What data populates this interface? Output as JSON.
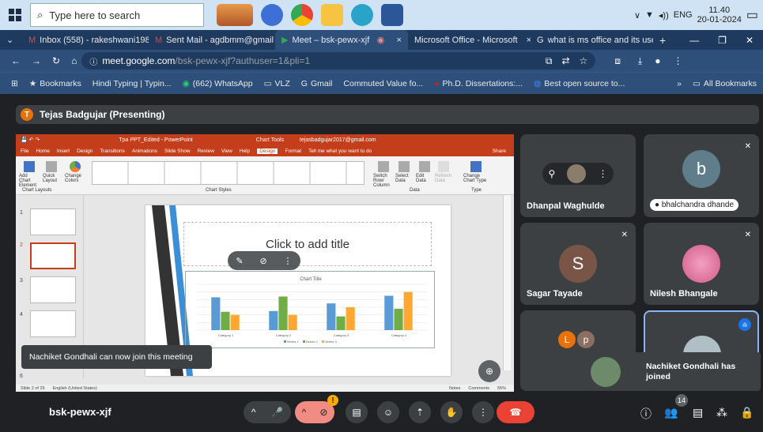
{
  "taskbar": {
    "search_placeholder": "Type here to search",
    "lang": "ENG",
    "time": "11.40",
    "date": "20-01-2024"
  },
  "tabs": [
    {
      "label": "Inbox (558) - rakeshwani198",
      "close": "×"
    },
    {
      "label": "Sent Mail - agdbmm@gmail",
      "close": "×"
    },
    {
      "label": "Meet – bsk-pewx-xjf",
      "close": "×"
    },
    {
      "label": "Microsoft Office - Microsoft",
      "close": "×"
    },
    {
      "label": "what is ms office and its use",
      "close": "×"
    }
  ],
  "new_tab": "+",
  "address": {
    "host": "meet.google.com",
    "path": "/bsk-pewx-xjf?authuser=1&pli=1"
  },
  "bookmarks": [
    "Bookmarks",
    "Hindi Typing | Typin...",
    "(662) WhatsApp",
    "VLZ",
    "Gmail",
    "Commuted Value fo...",
    "Ph.D. Dissertations:...",
    "Best open source to..."
  ],
  "bookmarks_more": "»",
  "all_bookmarks": "All Bookmarks",
  "presenter": {
    "initial": "T",
    "label": "Tejas Badgujar (Presenting)"
  },
  "ppt": {
    "title": "Tpa PPT_Edited - PowerPoint",
    "chart_tools": "Chart Tools",
    "account": "tejasbadgujar2017@gmail.com",
    "menu": [
      "File",
      "Home",
      "Insert",
      "Design",
      "Transitions",
      "Animations",
      "Slide Show",
      "Review",
      "View",
      "Help",
      "Design",
      "Format"
    ],
    "tellme": "Tell me what you want to do",
    "share": "Share",
    "ribbon": {
      "add_chart": "Add Chart Element",
      "quick": "Quick Layout",
      "change_colors": "Change Colors",
      "chart_layouts": "Chart Layouts",
      "chart_styles": "Chart Styles",
      "switch": "Switch Row/ Column",
      "select": "Select Data",
      "edit": "Edit Data",
      "refresh": "Refresh Data",
      "data": "Data",
      "change_type": "Change Chart Type",
      "type": "Type"
    },
    "slide_numbers": [
      "1",
      "2",
      "3",
      "4",
      "6"
    ],
    "slide_title": "Click to add title",
    "chart_title": "Chart Title",
    "status": {
      "slide": "Slide 2 of 29",
      "lang": "English (United States)",
      "notes": "Notes",
      "comments": "Comments",
      "zoom": "55%"
    }
  },
  "chart_data": {
    "type": "bar",
    "categories": [
      "Category 1",
      "Category 2",
      "Category 3",
      "Category 4"
    ],
    "series": [
      {
        "name": "Series 1",
        "values": [
          4.3,
          2.5,
          3.5,
          4.5
        ]
      },
      {
        "name": "Series 2",
        "values": [
          2.4,
          4.4,
          1.8,
          2.8
        ]
      },
      {
        "name": "Series 3",
        "values": [
          2,
          2,
          3,
          5
        ]
      }
    ],
    "title": "Chart Title",
    "ylim": [
      0,
      6
    ],
    "colors": [
      "#5b9bd5",
      "#70ad47",
      "#ffa733"
    ]
  },
  "participants": [
    {
      "name": "Dhanpal Waghulde"
    },
    {
      "name": "bhalchandra dhande",
      "initial": "b",
      "color": "#607d8b"
    },
    {
      "name": "Sagar Tayade",
      "initial": "S",
      "color": "#795548"
    },
    {
      "name": "Nilesh Bhangale"
    },
    {
      "initials": [
        "L",
        "p"
      ]
    }
  ],
  "toast_join": "Nachiket Gondhali can now join this meeting",
  "toast_joined": "Nachiket Gondhali has joined",
  "meeting_code": "bsk-pewx-xjf",
  "participant_count": "14",
  "accent": "#8ab4f8",
  "end_call_color": "#ea4335"
}
